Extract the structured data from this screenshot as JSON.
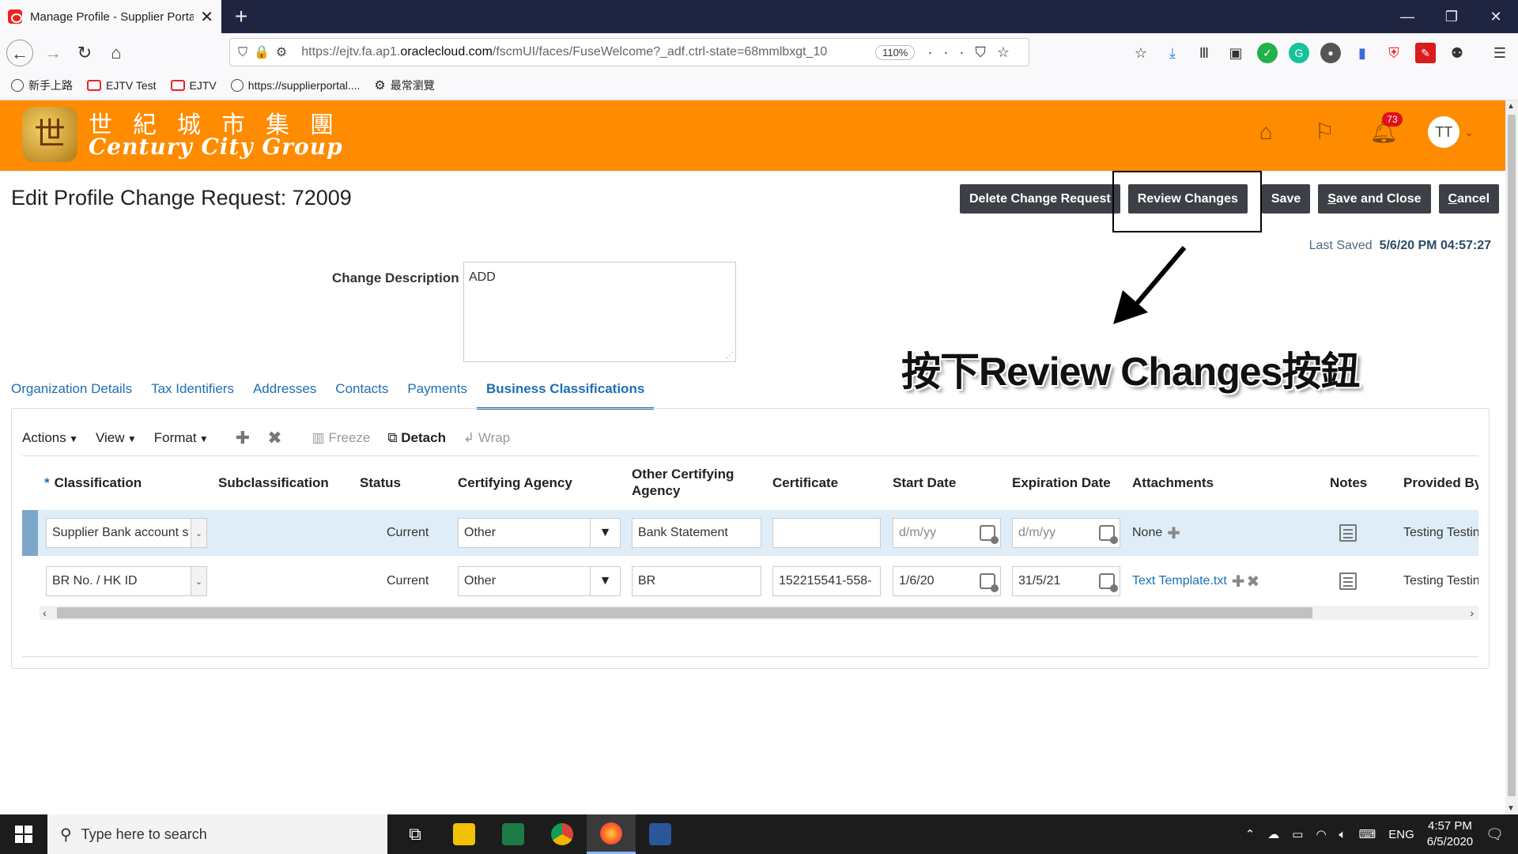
{
  "browser": {
    "tab_title": "Manage Profile - Supplier Porta",
    "url_prefix": "https://ejtv.fa.ap1.",
    "url_domain": "oraclecloud.com",
    "url_rest": "/fscmUI/faces/FuseWelcome?_adf.ctrl-state=68mmlbxgt_10",
    "zoom": "110%",
    "bookmarks": [
      "新手上路",
      "EJTV Test",
      "EJTV",
      "https://supplierportal....",
      "最常瀏覽"
    ]
  },
  "brand": {
    "name_cn": "世紀城市集團",
    "name_en": "Century City Group",
    "notification_count": "73",
    "avatar_initials": "TT"
  },
  "page": {
    "title": "Edit Profile Change Request: 72009",
    "buttons": {
      "delete": "Delete Change Request",
      "review": "Review Changes",
      "save": "Save",
      "save_close_first": "S",
      "save_close_rest": "ave and Close",
      "cancel_first": "C",
      "cancel_rest": "ancel"
    },
    "last_saved_label": "Last Saved",
    "last_saved_value": "5/6/20 PM 04:57:27",
    "change_description_label": "Change Description",
    "change_description_value": "ADD",
    "callout": "按下Review Changes按鈕"
  },
  "tabs": [
    "Organization Details",
    "Tax Identifiers",
    "Addresses",
    "Contacts",
    "Payments",
    "Business Classifications"
  ],
  "grid_toolbar": {
    "actions": "Actions",
    "view": "View",
    "format": "Format",
    "freeze": "Freeze",
    "detach": "Detach",
    "wrap": "Wrap"
  },
  "columns": {
    "classification": "Classification",
    "subclassification": "Subclassification",
    "status": "Status",
    "certifying_agency": "Certifying Agency",
    "other_certifying_agency": "Other Certifying Agency",
    "certificate": "Certificate",
    "start_date": "Start Date",
    "expiration_date": "Expiration Date",
    "attachments": "Attachments",
    "notes": "Notes",
    "provided_by": "Provided By"
  },
  "rows": [
    {
      "classification": "Supplier Bank account s",
      "status": "Current",
      "certifying_agency": "Other",
      "other_certifying_agency": "Bank Statement",
      "certificate": "",
      "start_date_placeholder": "d/m/yy",
      "expiration_date_placeholder": "d/m/yy",
      "attachments": "None",
      "provided_by": "Testing Testin"
    },
    {
      "classification": "BR No. / HK ID",
      "status": "Current",
      "certifying_agency": "Other",
      "other_certifying_agency": "BR",
      "certificate": "152215541-558-",
      "start_date": "1/6/20",
      "expiration_date": "31/5/21",
      "attachments": "Text Template.txt",
      "provided_by": "Testing Testin"
    }
  ],
  "taskbar": {
    "search_placeholder": "Type here to search",
    "language": "ENG",
    "time": "4:57 PM",
    "date": "6/5/2020"
  },
  "colors": {
    "brand_orange": "#ff8b00",
    "link_blue": "#1f6fb2",
    "button_dark": "#3d4046"
  }
}
